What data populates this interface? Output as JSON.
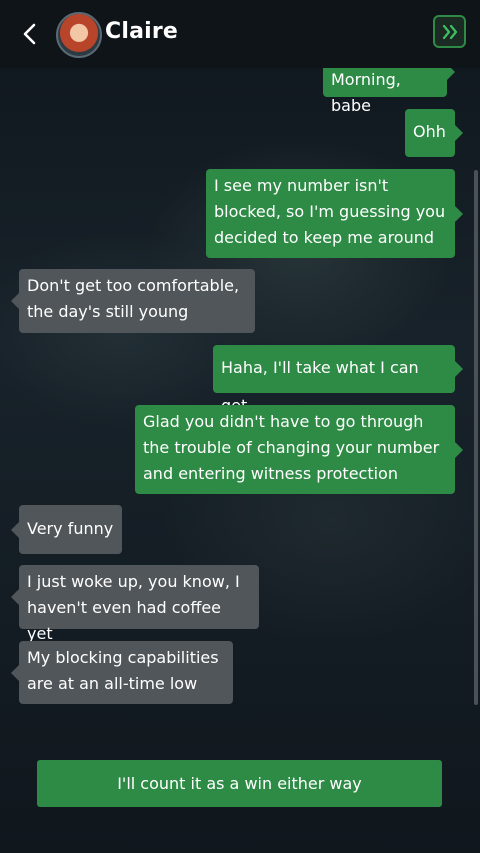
{
  "header": {
    "contact_name": "Claire",
    "back_icon": "chevron-left-icon",
    "skip_icon": "double-chevron-right-icon",
    "accent_color": "#2e8b45"
  },
  "messages": [
    {
      "side": "out",
      "text": "Morning, babe"
    },
    {
      "side": "out",
      "text": "Ohh"
    },
    {
      "side": "out",
      "text": "I see my number isn't blocked, so I'm guessing you decided to keep me around"
    },
    {
      "side": "in",
      "text": "Don't get too comfortable, the day's still young"
    },
    {
      "side": "out",
      "text": "Haha, I'll take what I can get"
    },
    {
      "side": "out",
      "text": "Glad you didn't have to go through the trouble of changing your number and entering witness protection"
    },
    {
      "side": "in",
      "text": "Very funny"
    },
    {
      "side": "in",
      "text": "I just woke up, you know, I haven't even had coffee yet"
    },
    {
      "side": "in",
      "text": "My blocking capabilities are at an all-time low"
    }
  ],
  "reply_option": "I'll count it as a win either way"
}
